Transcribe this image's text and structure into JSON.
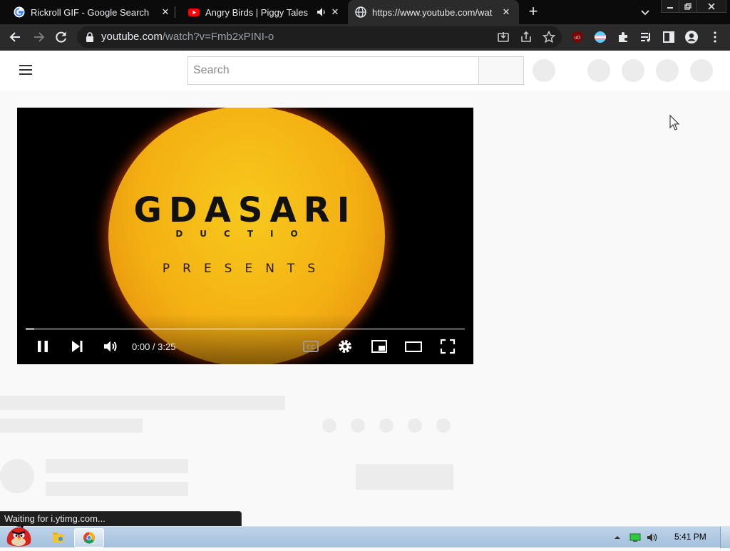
{
  "browser": {
    "tabs": [
      {
        "title": "Rickroll GIF - Google Search",
        "favicon": "google-icon",
        "active": false
      },
      {
        "title": "Angry Birds | Piggy Tales |",
        "favicon": "youtube-icon",
        "active": false,
        "audio": true
      },
      {
        "title": "https://www.youtube.com/wat",
        "favicon": "globe-icon",
        "active": true
      }
    ],
    "address_host": "youtube.com",
    "address_path": "/watch?v=Fmb2xPINI-o",
    "status_bubble": "Waiting for i.ytimg.com..."
  },
  "youtube": {
    "search_placeholder": "Search",
    "player": {
      "logo_main": "GDASARI",
      "logo_sub": "DUCTIO",
      "logo_presents": "PRESENTS",
      "time": "0:00 / 3:25",
      "buffered_fraction": 0.02
    }
  },
  "taskbar": {
    "clock": "5:41 PM"
  },
  "colors": {
    "tabstrip_bg": "#0b0b0b",
    "toolbar_bg": "#2b2b2b",
    "youtube_red": "#ff0000",
    "disc_yellow": "#f4b012"
  }
}
